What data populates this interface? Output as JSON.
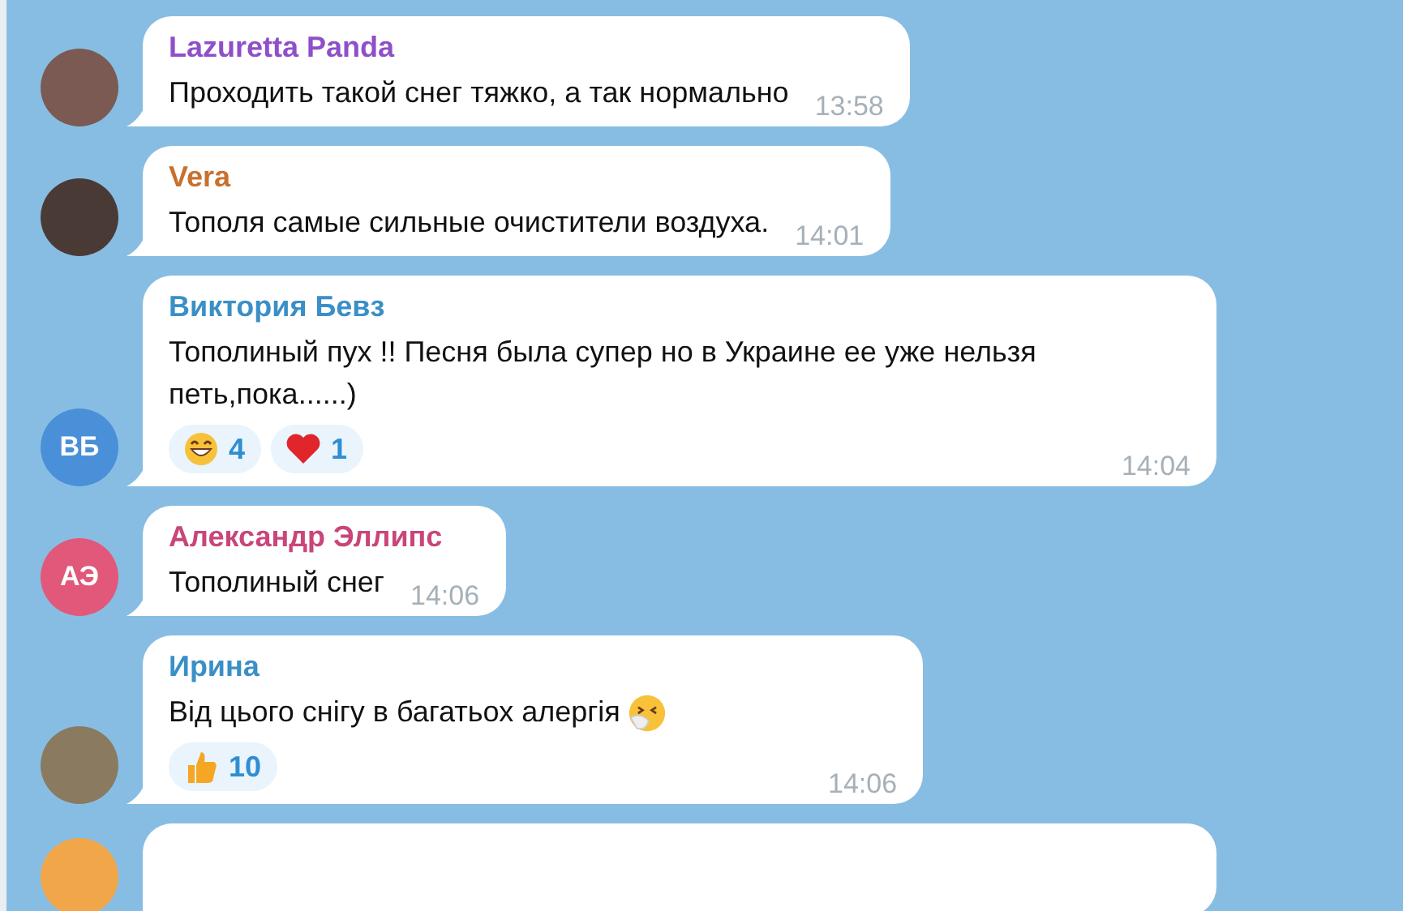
{
  "messages": [
    {
      "kind": "message",
      "author": "Lazuretta Panda",
      "color": "#8e4fc9",
      "avatar": {
        "kind": "photo",
        "color": "#7a5a52"
      },
      "text": "Проходить такой снег тяжко, а так нормально",
      "time": "13:58"
    },
    {
      "kind": "message",
      "author": "Vera",
      "color": "#c8702e",
      "avatar": {
        "kind": "photo",
        "color": "#4a3a36"
      },
      "text": "Тополя самые сильные очистители воздуха.",
      "time": "14:01"
    },
    {
      "kind": "message",
      "author": "Виктория Бевз",
      "color": "#3a8fc7",
      "avatar": {
        "kind": "initials",
        "initials": "ВБ",
        "color": "#4a90d9"
      },
      "text": "Тополиный пух !! Песня была супер но в Украине ее уже нельзя петь,пока......)",
      "time": "14:04",
      "reactions": [
        {
          "kind": "grin",
          "count": "4"
        },
        {
          "kind": "heart",
          "count": "1"
        }
      ]
    },
    {
      "kind": "message",
      "author": "Александр Эллипс",
      "color": "#c9457a",
      "avatar": {
        "kind": "initials",
        "initials": "АЭ",
        "color": "#e2587a"
      },
      "text": "Тополиный снег",
      "time": "14:06"
    },
    {
      "kind": "message",
      "author": "Ирина",
      "color": "#3a8fc7",
      "avatar": {
        "kind": "photo",
        "color": "#8a7a60"
      },
      "text": "Від цього снігу в багатьох алергія",
      "trailing": {
        "kind": "sneeze"
      },
      "time": "14:06",
      "reactions": [
        {
          "kind": "thumbs",
          "count": "10"
        }
      ]
    },
    {
      "kind": "cut",
      "avatar": {
        "kind": "initials",
        "color": "#f2a64a"
      }
    }
  ]
}
